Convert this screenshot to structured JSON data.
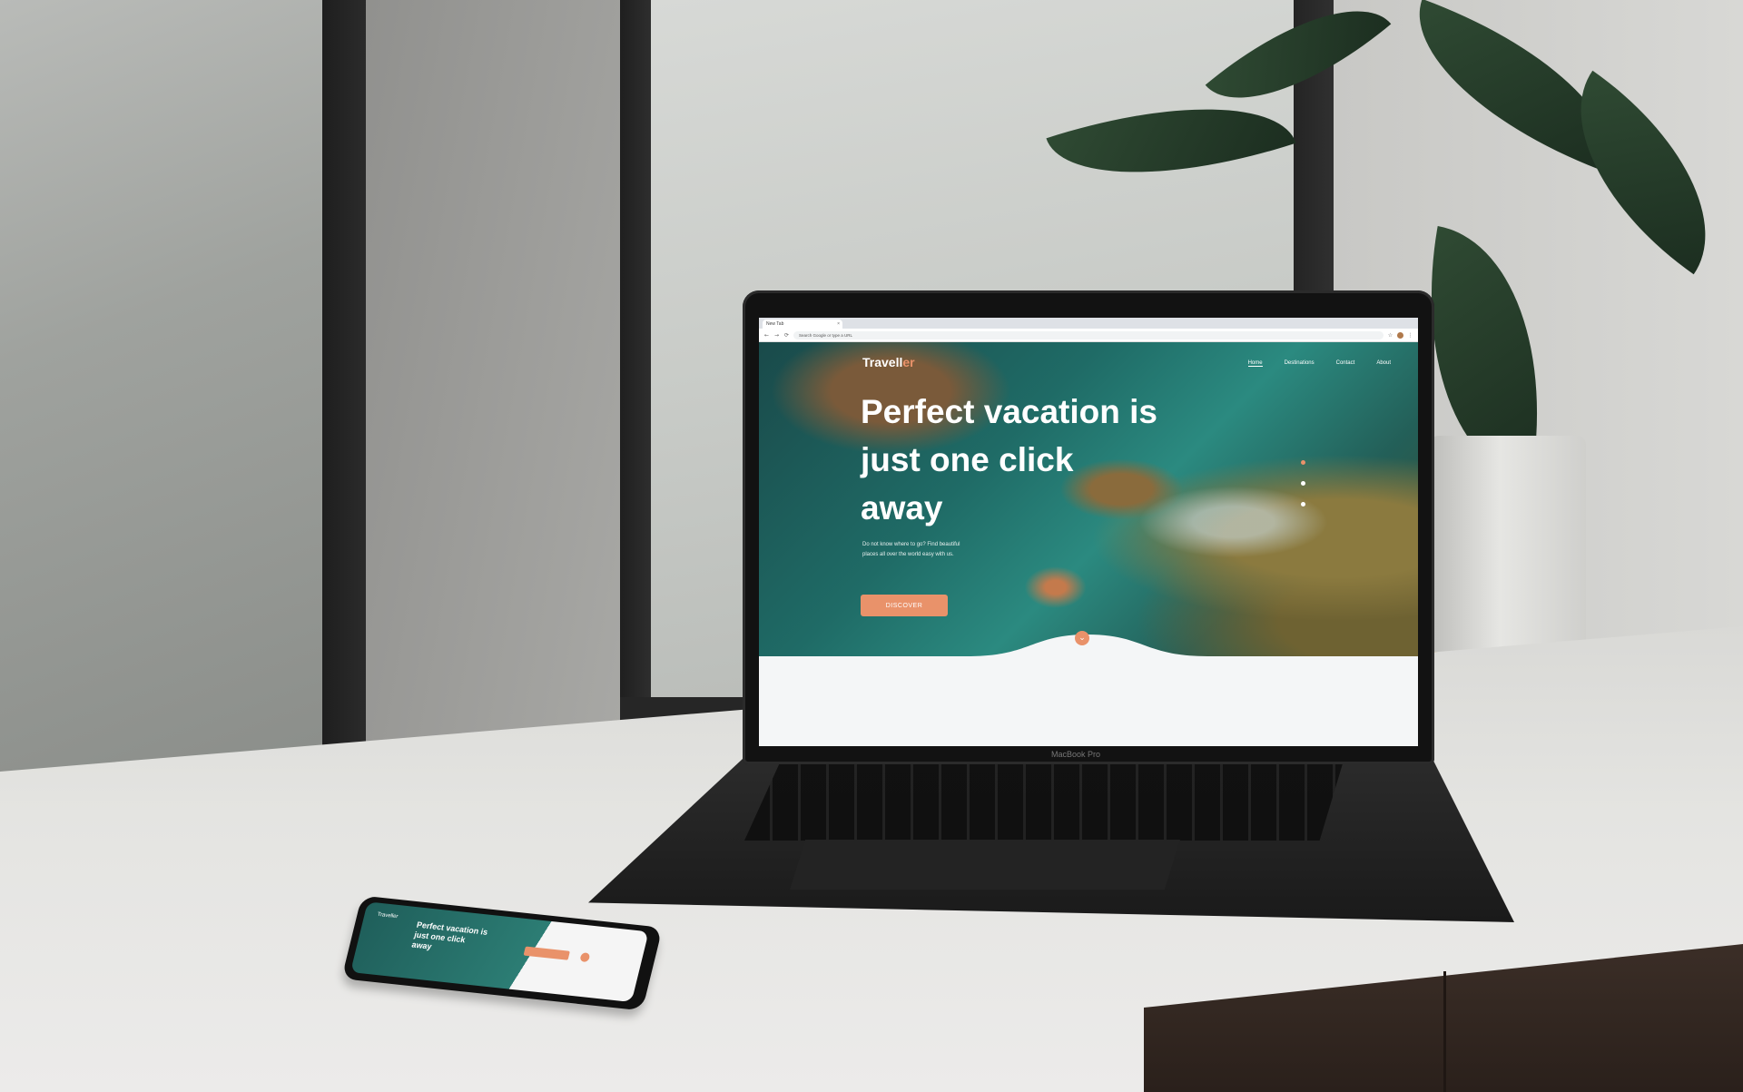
{
  "browser": {
    "tab_title": "New Tab",
    "tab_close": "×",
    "omnibox_text": "Search Google or type a URL",
    "nav_back": "←",
    "nav_forward": "→",
    "nav_reload": "⟳",
    "star_icon": "☆",
    "menu_icon": "⋮"
  },
  "site": {
    "brand_main": "Travell",
    "brand_accent": "er",
    "nav": [
      "Home",
      "Destinations",
      "Contact",
      "About"
    ],
    "headline_lines": [
      "Perfect vacation is",
      "just one click",
      "away"
    ],
    "subtext": "Do not know where to go? Find beautiful places all over the world easy with us.",
    "cta_label": "DISCOVER",
    "scroll_icon": "⌄",
    "accent_color": "#e9926a"
  },
  "device": {
    "laptop_label": "MacBook Pro"
  },
  "phone": {
    "brand": "Traveller",
    "headline": "Perfect vacation is just one click away"
  }
}
